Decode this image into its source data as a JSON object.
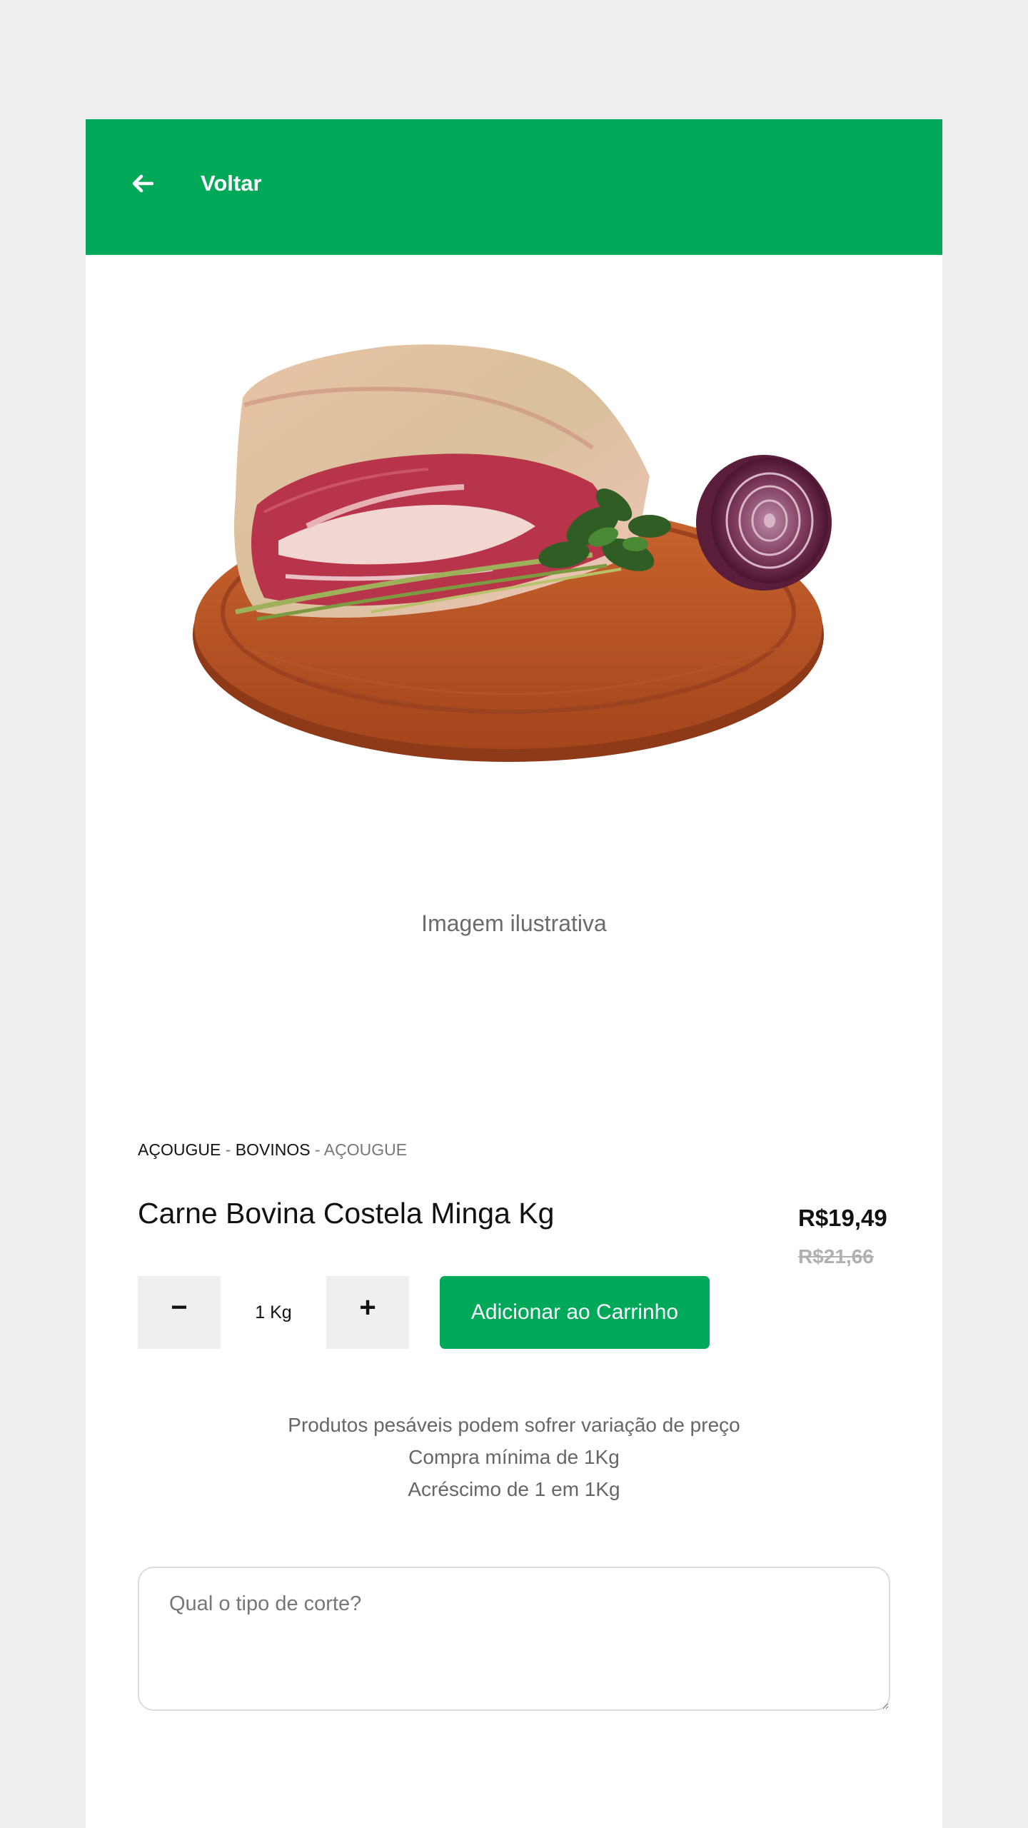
{
  "header": {
    "back_label": "Voltar",
    "back_icon": "arrow-left-icon",
    "color": "#00a859"
  },
  "product": {
    "image_caption": "Imagem ilustrativa",
    "breadcrumb": {
      "level1": "AÇOUGUE",
      "level2": "BOVINOS",
      "level3": "AÇOUGUE",
      "separator": "-"
    },
    "title": "Carne Bovina Costela Minga Kg",
    "price": "R$19,49",
    "old_price": "R$21,66"
  },
  "quantity": {
    "minus": "−",
    "value": "1 Kg",
    "plus": "+"
  },
  "actions": {
    "add_to_cart": "Adicionar ao Carrinho"
  },
  "notes": [
    "Produtos pesáveis podem sofrer variação de preço",
    "Compra mínima de 1Kg",
    "Acréscimo de 1 em 1Kg"
  ],
  "cut_field": {
    "placeholder": "Qual o tipo de corte?",
    "value": ""
  }
}
